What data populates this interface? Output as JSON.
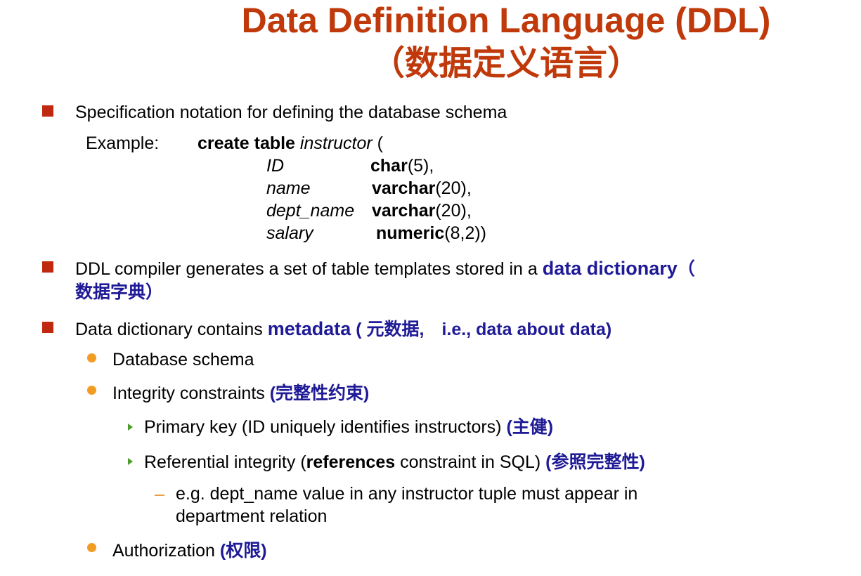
{
  "title": {
    "line1": "Data Definition Language (DDL)",
    "line2": "（数据定义语言）"
  },
  "colors": {
    "title": "#c0390b",
    "bullet_square": "#c0280f",
    "bullet_dot": "#f39c24",
    "bullet_arrow": "#4a9d2a",
    "emphasis_blue": "#1f1a96"
  },
  "bullets": {
    "spec": "Specification notation for defining the database schema",
    "example_label": "Example:",
    "example": {
      "create_kw": "create table",
      "table_name": "instructor",
      "open_paren": " (",
      "columns": [
        {
          "name": "ID",
          "type_kw": "char",
          "type_args": "(5),"
        },
        {
          "name": "name",
          "type_kw": "varchar",
          "type_args": "(20),"
        },
        {
          "name": "dept_name",
          "type_kw": "varchar",
          "type_args": "(20),"
        },
        {
          "name": "salary",
          "type_kw": "numeric",
          "type_args": "(8,2))"
        }
      ]
    },
    "ddl_compiler": {
      "text": "DDL compiler generates a set of table templates stored in a ",
      "term": "data dictionary",
      "paren_open": "（",
      "cn": "数据字典）"
    },
    "data_dict": {
      "text": "Data dictionary contains ",
      "term": "metadata",
      "rest": " ( 元数据,　i.e., data about data)"
    },
    "sub": {
      "schema": "Database schema",
      "integrity": {
        "text": "Integrity constraints ",
        "cn": "(完整性约束)"
      },
      "primary_key": {
        "text": "Primary key (ID uniquely identifies instructors) ",
        "cn": "(主健)"
      },
      "referential": {
        "before": "Referential integrity (",
        "kw": "references",
        "after": " constraint in SQL) ",
        "cn": "(参照完整性)"
      },
      "example_line1": "e.g. dept_name value in any instructor tuple must appear in",
      "example_line2": "department relation",
      "authorization": {
        "text": "Authorization ",
        "cn": "(权限)"
      }
    }
  }
}
